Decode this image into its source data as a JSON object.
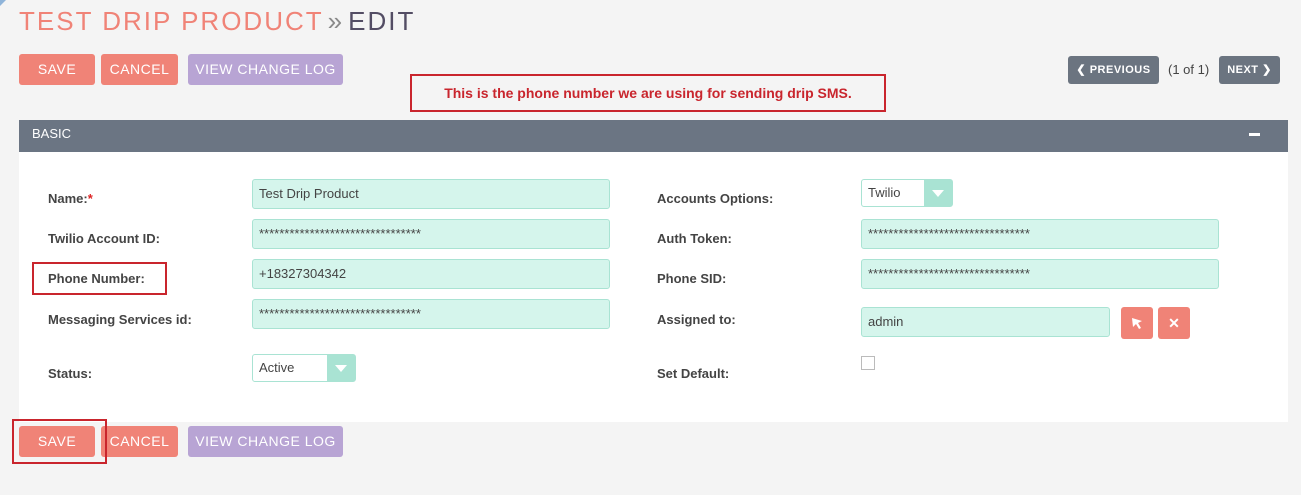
{
  "page": {
    "module": "TEST DRIP PRODUCT",
    "separator": "»",
    "action": "EDIT"
  },
  "toolbar": {
    "save": "SAVE",
    "cancel": "CANCEL",
    "view_change_log": "VIEW CHANGE LOG",
    "previous": "PREVIOUS",
    "next": "NEXT",
    "pager": "(1 of 1)"
  },
  "annotation": "This is the phone number we are using for sending drip SMS.",
  "panel": {
    "title": "BASIC"
  },
  "form": {
    "name": {
      "label": "Name:",
      "required": "*",
      "value": "Test Drip Product"
    },
    "twilio_account_id": {
      "label": "Twilio Account ID:",
      "value": "********************************"
    },
    "phone_number": {
      "label": "Phone Number:",
      "value": "+18327304342"
    },
    "messaging_services_id": {
      "label": "Messaging Services id:",
      "value": "********************************"
    },
    "status": {
      "label": "Status:",
      "value": "Active"
    },
    "accounts_options": {
      "label": "Accounts Options:",
      "value": "Twilio"
    },
    "auth_token": {
      "label": "Auth Token:",
      "value": "********************************"
    },
    "phone_sid": {
      "label": "Phone SID:",
      "value": "********************************"
    },
    "assigned_to": {
      "label": "Assigned to:",
      "value": "admin"
    },
    "set_default": {
      "label": "Set Default:",
      "checked": false
    }
  },
  "icons": {
    "select_user": "cursor-arrow-icon",
    "clear_user": "close-icon"
  },
  "colors": {
    "accent": "#f08377",
    "secondary_button": "#b8a4d4",
    "panel_header": "#6b7583",
    "field_bg": "#d5f5ec",
    "highlight": "#c9252d"
  }
}
